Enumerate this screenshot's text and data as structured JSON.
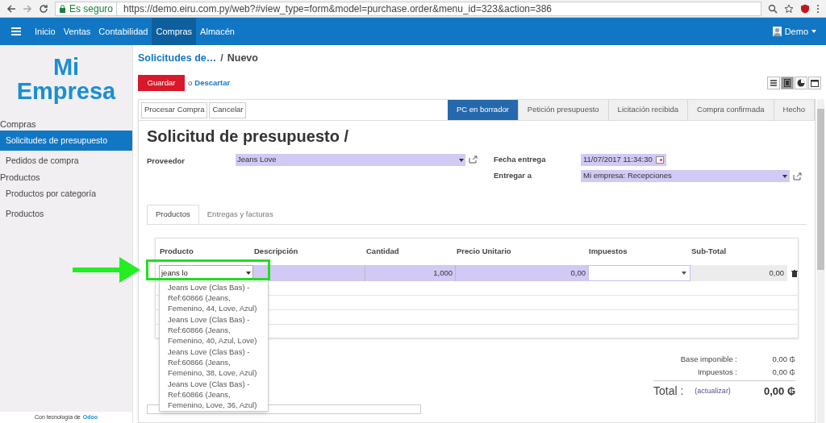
{
  "browser": {
    "secure_label": "Es seguro",
    "url": "https://demo.eiru.com.py/web?#view_type=form&model=purchase.order&menu_id=323&action=386"
  },
  "navbar": {
    "menu": [
      {
        "label": "Inicio",
        "selected": false
      },
      {
        "label": "Ventas",
        "selected": false
      },
      {
        "label": "Contabilidad",
        "selected": false
      },
      {
        "label": "Compras",
        "selected": true
      },
      {
        "label": "Almacén",
        "selected": false
      }
    ],
    "user": "Demo"
  },
  "sidebar": {
    "logo_lines": [
      "Mi",
      "Empresa"
    ],
    "sections": [
      {
        "title": "Compras",
        "items": [
          {
            "label": "Solicitudes de presupuesto",
            "selected": true
          },
          {
            "label": "Pedidos de compra",
            "selected": false
          }
        ]
      },
      {
        "title": "Productos",
        "items": [
          {
            "label": "Productos por categoría",
            "selected": false
          },
          {
            "label": "Productos",
            "selected": false
          }
        ]
      }
    ],
    "footer": {
      "text": "Con tecnología de",
      "link": "Odoo"
    }
  },
  "breadcrumb": {
    "parent": "Solicitudes de…",
    "separator": "/",
    "current": "Nuevo"
  },
  "actions": {
    "save": "Guardar",
    "or": "o",
    "discard": "Descartar"
  },
  "view_switcher": [
    {
      "kind": "list",
      "selected": false
    },
    {
      "kind": "form",
      "selected": true
    },
    {
      "kind": "graph",
      "selected": false
    },
    {
      "kind": "calendar",
      "selected": false
    }
  ],
  "form": {
    "header_buttons": [
      "Procesar Compra",
      "Cancelar"
    ],
    "stages": [
      {
        "label": "PC en borrador",
        "selected": true
      },
      {
        "label": "Petición presupuesto",
        "selected": false
      },
      {
        "label": "Licitación recibida",
        "selected": false
      },
      {
        "label": "Compra confirmada",
        "selected": false
      },
      {
        "label": "Hecho",
        "selected": false
      }
    ],
    "title": "Solicitud de presupuesto /",
    "supplier": {
      "label": "Proveedor",
      "value": "Jeans Love"
    },
    "delivery_date": {
      "label": "Fecha entrega",
      "value": "11/07/2017 11:34:30"
    },
    "deliver_to": {
      "label": "Entregar a",
      "value": "Mi empresa: Recepciones"
    },
    "tabs": [
      {
        "label": "Productos",
        "selected": true
      },
      {
        "label": "Entregas y facturas",
        "selected": false
      }
    ],
    "lines": {
      "columns": [
        "Producto",
        "Descripción",
        "Cantidad",
        "Precio Unitario",
        "Impuestos",
        "Sub-Total"
      ],
      "row": {
        "product": "jeans lo",
        "quantity": "1,000",
        "unit_price": "0,00",
        "subtotal": "0,00"
      },
      "suggestions": [
        "Jeans Love (Clas Bas) - Ref:60866 (Jeans, Femenino, 44, Love, Azul)",
        "Jeans Love (Clas Bas) - Ref:60866 (Jeans, Femenino, 40, Azul, Love)",
        "Jeans Love (Clas Bas) - Ref:60866 (Jeans, Femenino, 38, Love, Azul)",
        "Jeans Love (Clas Bas) - Ref:60866 (Jeans, Femenino, Love, 36, Azul)"
      ]
    },
    "totals": {
      "base": {
        "label": "Base imponible :",
        "value": "0,00 ₲"
      },
      "taxes": {
        "label": "Impuestos :",
        "value": "0,00 ₲"
      },
      "total": {
        "label": "Total :",
        "link": "(actualizar)",
        "value": "0,00 ₲"
      }
    }
  }
}
